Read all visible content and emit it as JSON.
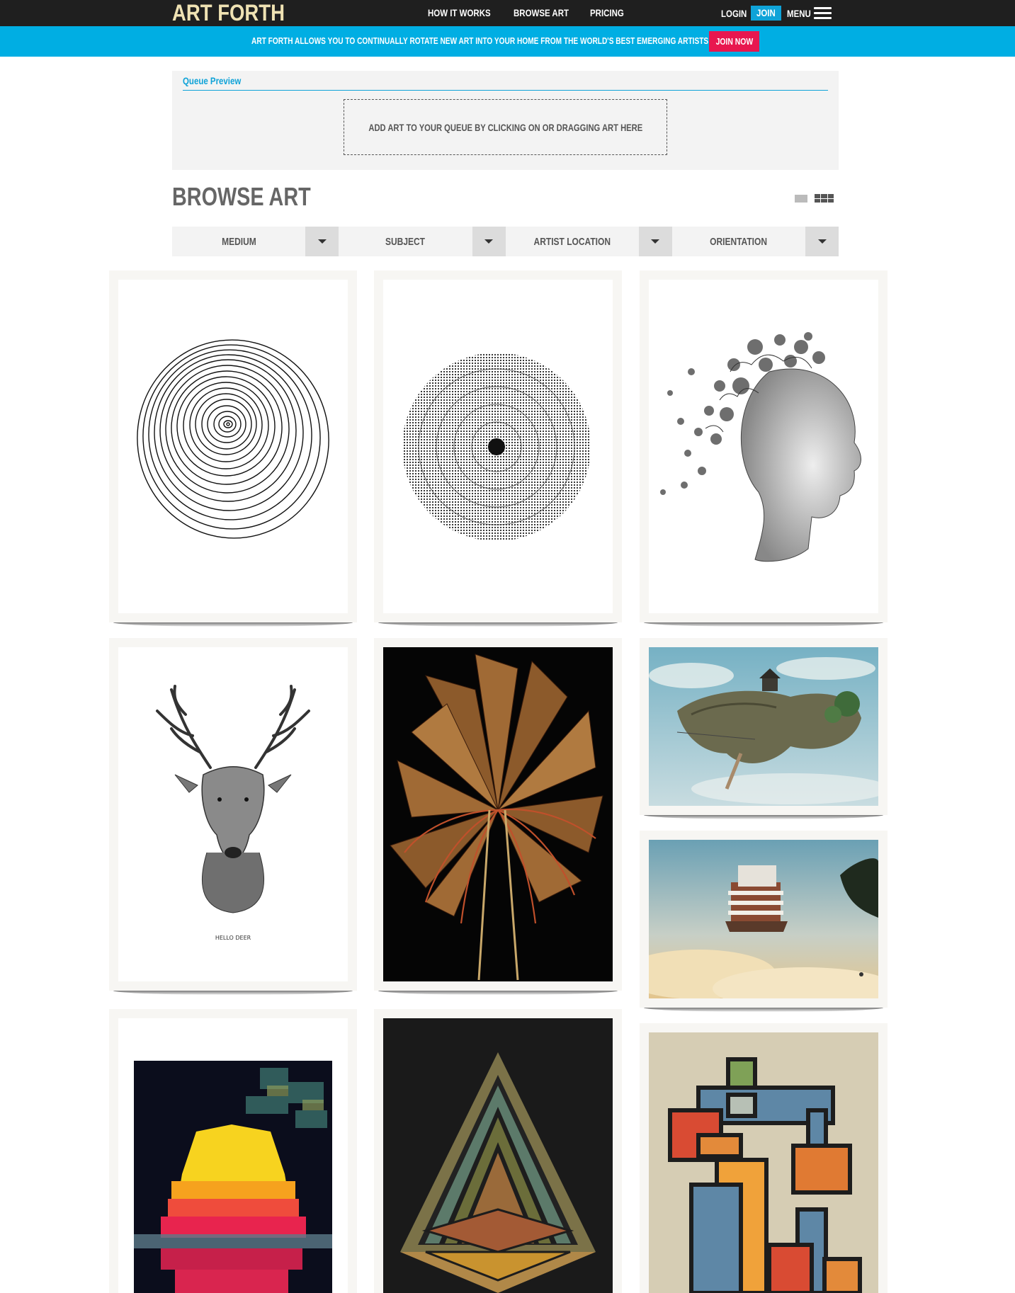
{
  "nav": {
    "logo": "ART FORTH",
    "links": [
      "HOW IT WORKS",
      "BROWSE ART",
      "PRICING"
    ],
    "login": "LOGIN",
    "join": "JOIN",
    "menu": "MENU"
  },
  "promo": {
    "text": "ART FORTH ALLOWS YOU TO CONTINUALLY ROTATE NEW ART INTO YOUR HOME FROM THE WORLD'S BEST EMERGING ARTISTS",
    "cta": "JOIN NOW"
  },
  "queue": {
    "title": "Queue Preview",
    "dropzone": "ADD ART TO YOUR QUEUE BY CLICKING ON OR DRAGGING ART HERE"
  },
  "browse": {
    "title": "BROWSE ART",
    "filters": [
      "MEDIUM",
      "SUBJECT",
      "ARTIST LOCATION",
      "ORIENTATION"
    ]
  },
  "artworks": [
    {
      "id": "tree-rings",
      "caption": ""
    },
    {
      "id": "dotted-circle",
      "caption": ""
    },
    {
      "id": "woman-profile",
      "caption": ""
    },
    {
      "id": "deer-head",
      "caption": "HELLO DEER"
    },
    {
      "id": "book-flower",
      "caption": ""
    },
    {
      "id": "floating-island",
      "caption": ""
    },
    {
      "id": "floating-building",
      "caption": ""
    },
    {
      "id": "pixel-sunset",
      "caption": ""
    },
    {
      "id": "triangle-geometric",
      "caption": ""
    },
    {
      "id": "color-blocks",
      "caption": ""
    }
  ],
  "colors": {
    "topbar": "#1f1f1f",
    "logo": "#efe2b3",
    "accent_blue": "#0fa3d8",
    "banner_blue": "#00aee3",
    "join_now_red": "#e8174f"
  }
}
